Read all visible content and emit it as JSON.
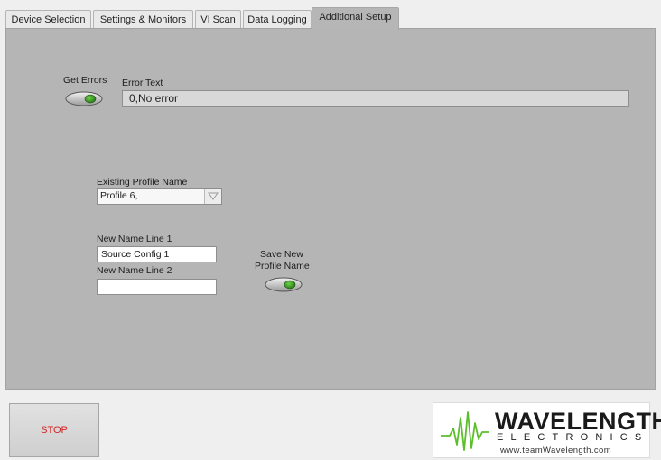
{
  "tabs": [
    {
      "label": "Device Selection"
    },
    {
      "label": "Settings & Monitors"
    },
    {
      "label": "VI Scan"
    },
    {
      "label": "Data Logging"
    },
    {
      "label": "Additional Setup",
      "active": true
    }
  ],
  "errors": {
    "get_errors_label": "Get Errors",
    "error_text_label": "Error Text",
    "error_text_value": "0,No error"
  },
  "profile": {
    "existing_label": "Existing Profile Name",
    "existing_value": "Profile 6,",
    "new_line1_label": "New Name Line 1",
    "new_line1_value": "Source Config 1",
    "new_line2_label": "New Name Line 2",
    "new_line2_value": "",
    "save_label_line1": "Save New",
    "save_label_line2": "Profile Name"
  },
  "stop": {
    "label": "STOP"
  },
  "logo": {
    "word": "WAVELENGTH",
    "sub": "ELECTRONICS",
    "url": "www.teamWavelength.com"
  },
  "colors": {
    "panel": "#b5b5b5",
    "led_green": "#2e8b1e",
    "stop_text": "#d32222",
    "logo_green": "#5bbf2a"
  }
}
